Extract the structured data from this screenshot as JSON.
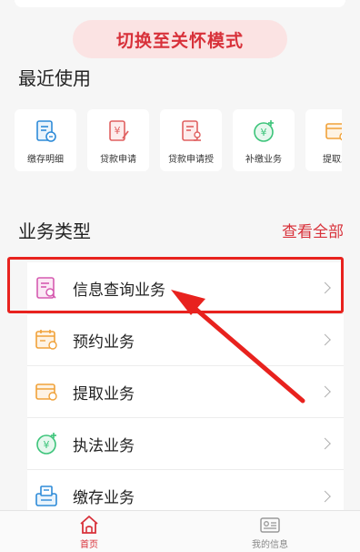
{
  "mode_button": "切换至关怀模式",
  "recent": {
    "title": "最近使用",
    "items": [
      {
        "label": "缴存明细",
        "icon": "deposit-detail-icon"
      },
      {
        "label": "贷款申请",
        "icon": "loan-apply-icon"
      },
      {
        "label": "贷款申请授",
        "icon": "loan-authorize-icon"
      },
      {
        "label": "补缴业务",
        "icon": "supplement-payment-icon"
      },
      {
        "label": "提取业",
        "icon": "withdraw-icon"
      }
    ]
  },
  "business": {
    "title": "业务类型",
    "view_all": "查看全部",
    "items": [
      {
        "label": "信息查询业务",
        "icon": "info-query-icon"
      },
      {
        "label": "预约业务",
        "icon": "appointment-icon"
      },
      {
        "label": "提取业务",
        "icon": "withdraw-icon"
      },
      {
        "label": "执法业务",
        "icon": "law-enforcement-icon"
      },
      {
        "label": "缴存业务",
        "icon": "deposit-icon"
      }
    ]
  },
  "tabbar": {
    "home": "首页",
    "mine": "我的信息"
  },
  "colors": {
    "accent": "#d8313a",
    "icon_blue": "#2e8bd8",
    "icon_orange": "#f0a23a",
    "icon_red": "#e06060",
    "icon_green": "#3cc47a",
    "icon_pink": "#d65bb0"
  }
}
